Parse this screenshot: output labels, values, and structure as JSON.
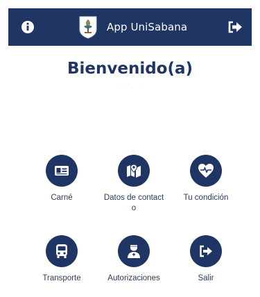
{
  "header": {
    "title": "App UniSabana",
    "info_icon": "info-icon",
    "logout_icon": "logout-icon",
    "logo_icon": "shield-logo-icon",
    "background": "#1f3563"
  },
  "welcome": {
    "title": "Bienvenido(a)",
    "subtitle": ". . . ."
  },
  "menu": {
    "accent": "#1f3563",
    "items": [
      {
        "label": "Carné",
        "icon": "id-card-icon"
      },
      {
        "label": "Datos de contacto",
        "icon": "map-location-icon"
      },
      {
        "label": "Tu condición",
        "icon": "heart-pulse-icon"
      },
      {
        "label": "Transporte",
        "icon": "bus-icon"
      },
      {
        "label": "Autorizaciones",
        "icon": "doctor-icon"
      },
      {
        "label": "Salir",
        "icon": "sign-out-icon"
      }
    ]
  }
}
